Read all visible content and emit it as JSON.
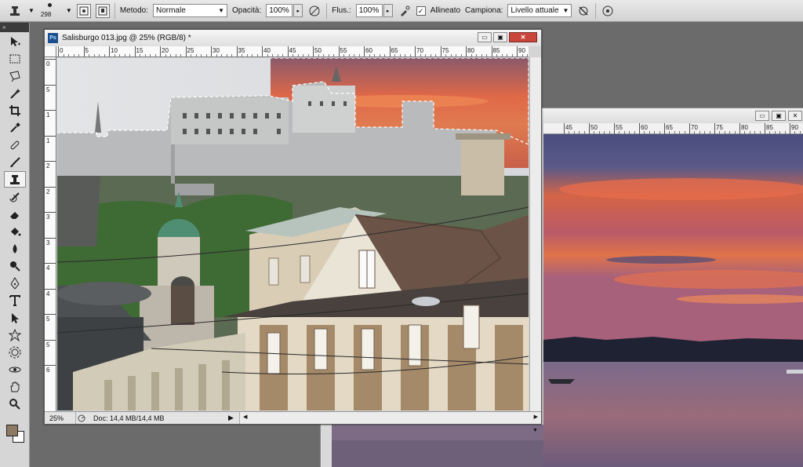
{
  "options_bar": {
    "brush_size": "298",
    "mode_label": "Metodo:",
    "mode_value": "Normale",
    "opacity_label": "Opacità:",
    "opacity_value": "100%",
    "flow_label": "Flus.:",
    "flow_value": "100%",
    "aligned_label": "Allineato",
    "aligned_checked": true,
    "sample_label": "Campiona:",
    "sample_value": "Livello attuale"
  },
  "tools_panel": {
    "grip": "»",
    "tools": [
      "move-tool",
      "marquee-tool",
      "lasso-tool",
      "magic-wand-tool",
      "crop-tool",
      "eyedropper-tool",
      "healing-brush-tool",
      "brush-tool",
      "clone-stamp-tool",
      "history-brush-tool",
      "eraser-tool",
      "paint-bucket-tool",
      "blur-tool",
      "dodge-tool",
      "pen-tool",
      "type-tool",
      "path-selection-tool",
      "custom-shape-tool",
      "3d-rotate-tool",
      "3d-orbit-tool",
      "hand-tool",
      "zoom-tool"
    ],
    "foreground_color": "#8e7a62",
    "background_color": "#ffffff"
  },
  "main_window": {
    "title": "Salisburgo 013.jpg @ 25% (RGB/8) *",
    "zoom": "25%",
    "doc_info": "Doc: 14,4 MB/14,4 MB",
    "ruler_h": [
      "0",
      "5",
      "10",
      "15",
      "20",
      "25",
      "30",
      "35",
      "40",
      "45",
      "50",
      "55",
      "60",
      "65",
      "70",
      "75",
      "80",
      "85",
      "90"
    ],
    "ruler_v": [
      "0",
      "5",
      "1",
      "1",
      "2",
      "2",
      "3",
      "3",
      "4",
      "4",
      "5",
      "5",
      "6"
    ]
  },
  "secondary_window": {
    "ruler_h": [
      "45",
      "50",
      "55",
      "60",
      "65",
      "70",
      "75",
      "80",
      "85",
      "90"
    ]
  }
}
